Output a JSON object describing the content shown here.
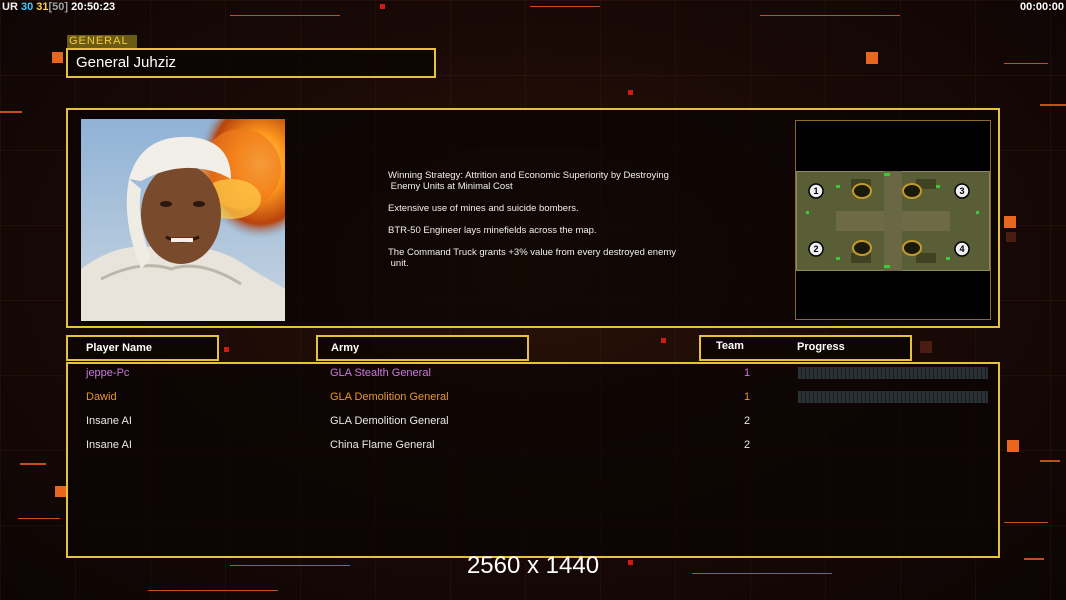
{
  "topbar": {
    "ur_label": "UR",
    "ur_val1": "30",
    "ur_val2": "31",
    "ur_val3": "[50]",
    "time": "20:50:23",
    "clock": "00:00:00"
  },
  "general": {
    "tag": "GENERAL",
    "name": "General Juhziz",
    "strategy": [
      "Winning Strategy: Attrition and Economic Superiority by Destroying\n Enemy Units at Minimal Cost",
      "Extensive use of mines and suicide bombers.",
      "BTR-50 Engineer lays minefields across the map.",
      "The Command Truck grants +3% value from every destroyed enemy\n unit."
    ],
    "map_slots": [
      "1",
      "2",
      "3",
      "4"
    ]
  },
  "table": {
    "col_player": "Player Name",
    "col_army": "Army",
    "col_team": "Team",
    "col_progress": "Progress",
    "rows": [
      {
        "name": "jeppe-Pc",
        "army": "GLA Stealth General",
        "team": "1",
        "color": "#c878e0",
        "progress": 0
      },
      {
        "name": "Dawid",
        "army": "GLA Demolition General",
        "team": "1",
        "color": "#e8962c",
        "progress": 0
      },
      {
        "name": "Insane AI",
        "army": "GLA Demolition General",
        "team": "2",
        "color": "#e8e8e8"
      },
      {
        "name": "Insane AI",
        "army": "China Flame General",
        "team": "2",
        "color": "#e8e8e8"
      }
    ]
  },
  "overlay": {
    "resolution": "2560 x 1440"
  },
  "colors": {
    "frame": "#e6c23a",
    "accent": "#e8661e"
  }
}
